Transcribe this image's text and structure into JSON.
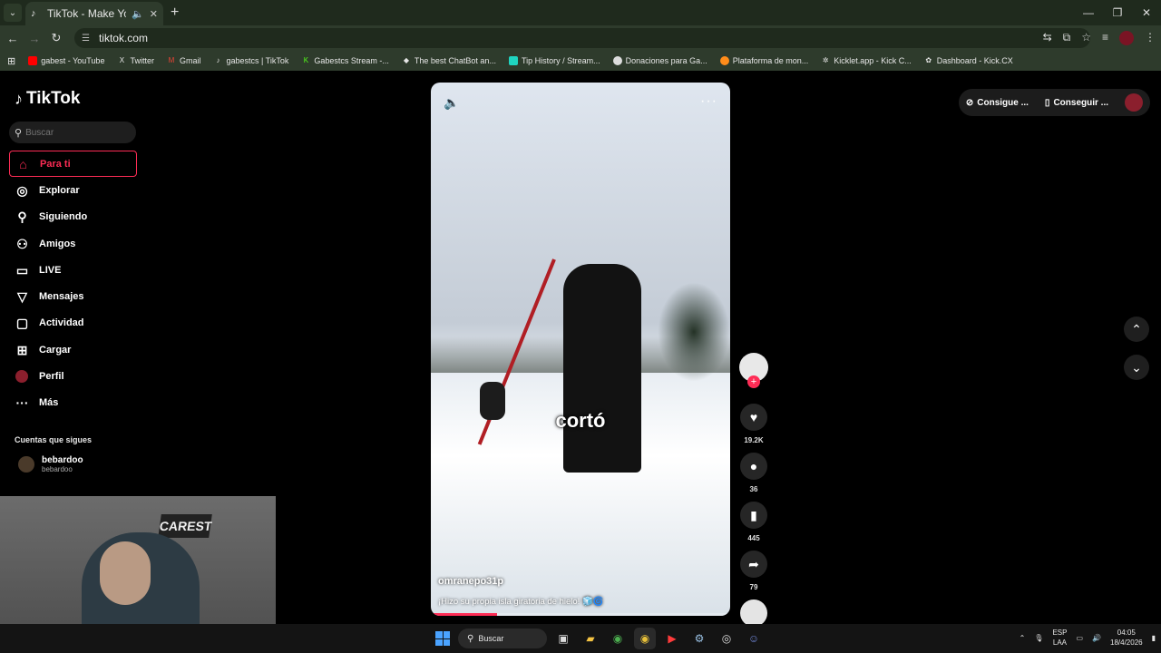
{
  "browser": {
    "tab_title": "TikTok - Make Your Day",
    "url": "tiktok.com",
    "bookmarks": [
      {
        "label": "gabest - YouTube",
        "color": "#ff0000"
      },
      {
        "label": "Twitter",
        "color": "#ffffff"
      },
      {
        "label": "Gmail",
        "color": "#ea4335"
      },
      {
        "label": "gabestcs | TikTok",
        "color": "#ffffff"
      },
      {
        "label": "Gabestcs Stream -...",
        "color": "#53fc18"
      },
      {
        "label": "The best ChatBot an...",
        "color": "#ffffff"
      },
      {
        "label": "Tip History / Stream...",
        "color": "#1fd4c0"
      },
      {
        "label": "Donaciones para Ga...",
        "color": "#dddddd"
      },
      {
        "label": "Plataforma de mon...",
        "color": "#ff8c1a"
      },
      {
        "label": "Kicklet.app - Kick C...",
        "color": "#cccccc"
      },
      {
        "label": "Dashboard - Kick.CX",
        "color": "#dddddd"
      }
    ]
  },
  "sidebar": {
    "logo": "TikTok",
    "search_placeholder": "Buscar",
    "items": [
      {
        "label": "Para ti",
        "icon": "home-icon",
        "glyph": "⌂"
      },
      {
        "label": "Explorar",
        "icon": "compass-icon",
        "glyph": "◎"
      },
      {
        "label": "Siguiendo",
        "icon": "user-follow-icon",
        "glyph": "⚲"
      },
      {
        "label": "Amigos",
        "icon": "friends-icon",
        "glyph": "⚇"
      },
      {
        "label": "LIVE",
        "icon": "live-tv-icon",
        "glyph": "▭"
      },
      {
        "label": "Mensajes",
        "icon": "messages-icon",
        "glyph": "▽"
      },
      {
        "label": "Actividad",
        "icon": "activity-icon",
        "glyph": "▢"
      },
      {
        "label": "Cargar",
        "icon": "upload-icon",
        "glyph": "⊞"
      },
      {
        "label": "Perfil",
        "icon": "profile-avatar-icon",
        "glyph": ""
      },
      {
        "label": "Más",
        "icon": "more-icon",
        "glyph": "···"
      }
    ],
    "following_title": "Cuentas que sigues",
    "following": [
      {
        "name": "bebardoo",
        "handle": "bebardoo"
      }
    ]
  },
  "webcam": {
    "chair_text": "CAREST"
  },
  "video": {
    "caption_overlay": "cortó",
    "author": "omranepo31p",
    "description": "¡Hizo su propia isla giratoria de hielo! 🧊🌀",
    "progress": 0.22
  },
  "actions": {
    "likes": "19.2K",
    "comments": "36",
    "saves": "445",
    "shares": "79"
  },
  "topbar": {
    "get_coins": "Consigue ...",
    "get_app": "Conseguir ..."
  },
  "taskbar": {
    "search_label": "Buscar",
    "lang_line1": "ESP",
    "lang_line2": "LAA",
    "time": "04:05",
    "date": "18/4/2026"
  },
  "colors": {
    "accent": "#fe2c55",
    "chrome_bg": "#2e3b2c"
  }
}
